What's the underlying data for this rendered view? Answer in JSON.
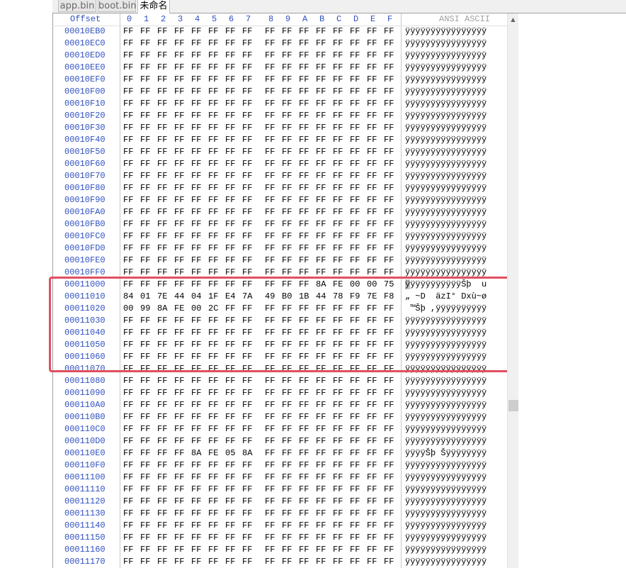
{
  "tabs": [
    {
      "label": "app.bin",
      "active": false
    },
    {
      "label": "boot.bin",
      "active": false
    },
    {
      "label": "未命名",
      "active": true
    }
  ],
  "header": {
    "offset_label": "Offset",
    "columns": [
      "0",
      "1",
      "2",
      "3",
      "4",
      "5",
      "6",
      "7",
      "8",
      "9",
      "A",
      "B",
      "C",
      "D",
      "E",
      "F"
    ],
    "ascii_label": "ANSI ASCII"
  },
  "rows": [
    {
      "offset": "00010EB0",
      "bytes": [
        "FF",
        "FF",
        "FF",
        "FF",
        "FF",
        "FF",
        "FF",
        "FF",
        "FF",
        "FF",
        "FF",
        "FF",
        "FF",
        "FF",
        "FF",
        "FF"
      ],
      "ascii": "ÿÿÿÿÿÿÿÿÿÿÿÿÿÿÿÿ"
    },
    {
      "offset": "00010EC0",
      "bytes": [
        "FF",
        "FF",
        "FF",
        "FF",
        "FF",
        "FF",
        "FF",
        "FF",
        "FF",
        "FF",
        "FF",
        "FF",
        "FF",
        "FF",
        "FF",
        "FF"
      ],
      "ascii": "ÿÿÿÿÿÿÿÿÿÿÿÿÿÿÿÿ"
    },
    {
      "offset": "00010ED0",
      "bytes": [
        "FF",
        "FF",
        "FF",
        "FF",
        "FF",
        "FF",
        "FF",
        "FF",
        "FF",
        "FF",
        "FF",
        "FF",
        "FF",
        "FF",
        "FF",
        "FF"
      ],
      "ascii": "ÿÿÿÿÿÿÿÿÿÿÿÿÿÿÿÿ"
    },
    {
      "offset": "00010EE0",
      "bytes": [
        "FF",
        "FF",
        "FF",
        "FF",
        "FF",
        "FF",
        "FF",
        "FF",
        "FF",
        "FF",
        "FF",
        "FF",
        "FF",
        "FF",
        "FF",
        "FF"
      ],
      "ascii": "ÿÿÿÿÿÿÿÿÿÿÿÿÿÿÿÿ"
    },
    {
      "offset": "00010EF0",
      "bytes": [
        "FF",
        "FF",
        "FF",
        "FF",
        "FF",
        "FF",
        "FF",
        "FF",
        "FF",
        "FF",
        "FF",
        "FF",
        "FF",
        "FF",
        "FF",
        "FF"
      ],
      "ascii": "ÿÿÿÿÿÿÿÿÿÿÿÿÿÿÿÿ"
    },
    {
      "offset": "00010F00",
      "bytes": [
        "FF",
        "FF",
        "FF",
        "FF",
        "FF",
        "FF",
        "FF",
        "FF",
        "FF",
        "FF",
        "FF",
        "FF",
        "FF",
        "FF",
        "FF",
        "FF"
      ],
      "ascii": "ÿÿÿÿÿÿÿÿÿÿÿÿÿÿÿÿ"
    },
    {
      "offset": "00010F10",
      "bytes": [
        "FF",
        "FF",
        "FF",
        "FF",
        "FF",
        "FF",
        "FF",
        "FF",
        "FF",
        "FF",
        "FF",
        "FF",
        "FF",
        "FF",
        "FF",
        "FF"
      ],
      "ascii": "ÿÿÿÿÿÿÿÿÿÿÿÿÿÿÿÿ"
    },
    {
      "offset": "00010F20",
      "bytes": [
        "FF",
        "FF",
        "FF",
        "FF",
        "FF",
        "FF",
        "FF",
        "FF",
        "FF",
        "FF",
        "FF",
        "FF",
        "FF",
        "FF",
        "FF",
        "FF"
      ],
      "ascii": "ÿÿÿÿÿÿÿÿÿÿÿÿÿÿÿÿ"
    },
    {
      "offset": "00010F30",
      "bytes": [
        "FF",
        "FF",
        "FF",
        "FF",
        "FF",
        "FF",
        "FF",
        "FF",
        "FF",
        "FF",
        "FF",
        "FF",
        "FF",
        "FF",
        "FF",
        "FF"
      ],
      "ascii": "ÿÿÿÿÿÿÿÿÿÿÿÿÿÿÿÿ"
    },
    {
      "offset": "00010F40",
      "bytes": [
        "FF",
        "FF",
        "FF",
        "FF",
        "FF",
        "FF",
        "FF",
        "FF",
        "FF",
        "FF",
        "FF",
        "FF",
        "FF",
        "FF",
        "FF",
        "FF"
      ],
      "ascii": "ÿÿÿÿÿÿÿÿÿÿÿÿÿÿÿÿ"
    },
    {
      "offset": "00010F50",
      "bytes": [
        "FF",
        "FF",
        "FF",
        "FF",
        "FF",
        "FF",
        "FF",
        "FF",
        "FF",
        "FF",
        "FF",
        "FF",
        "FF",
        "FF",
        "FF",
        "FF"
      ],
      "ascii": "ÿÿÿÿÿÿÿÿÿÿÿÿÿÿÿÿ"
    },
    {
      "offset": "00010F60",
      "bytes": [
        "FF",
        "FF",
        "FF",
        "FF",
        "FF",
        "FF",
        "FF",
        "FF",
        "FF",
        "FF",
        "FF",
        "FF",
        "FF",
        "FF",
        "FF",
        "FF"
      ],
      "ascii": "ÿÿÿÿÿÿÿÿÿÿÿÿÿÿÿÿ"
    },
    {
      "offset": "00010F70",
      "bytes": [
        "FF",
        "FF",
        "FF",
        "FF",
        "FF",
        "FF",
        "FF",
        "FF",
        "FF",
        "FF",
        "FF",
        "FF",
        "FF",
        "FF",
        "FF",
        "FF"
      ],
      "ascii": "ÿÿÿÿÿÿÿÿÿÿÿÿÿÿÿÿ"
    },
    {
      "offset": "00010F80",
      "bytes": [
        "FF",
        "FF",
        "FF",
        "FF",
        "FF",
        "FF",
        "FF",
        "FF",
        "FF",
        "FF",
        "FF",
        "FF",
        "FF",
        "FF",
        "FF",
        "FF"
      ],
      "ascii": "ÿÿÿÿÿÿÿÿÿÿÿÿÿÿÿÿ"
    },
    {
      "offset": "00010F90",
      "bytes": [
        "FF",
        "FF",
        "FF",
        "FF",
        "FF",
        "FF",
        "FF",
        "FF",
        "FF",
        "FF",
        "FF",
        "FF",
        "FF",
        "FF",
        "FF",
        "FF"
      ],
      "ascii": "ÿÿÿÿÿÿÿÿÿÿÿÿÿÿÿÿ"
    },
    {
      "offset": "00010FA0",
      "bytes": [
        "FF",
        "FF",
        "FF",
        "FF",
        "FF",
        "FF",
        "FF",
        "FF",
        "FF",
        "FF",
        "FF",
        "FF",
        "FF",
        "FF",
        "FF",
        "FF"
      ],
      "ascii": "ÿÿÿÿÿÿÿÿÿÿÿÿÿÿÿÿ"
    },
    {
      "offset": "00010FB0",
      "bytes": [
        "FF",
        "FF",
        "FF",
        "FF",
        "FF",
        "FF",
        "FF",
        "FF",
        "FF",
        "FF",
        "FF",
        "FF",
        "FF",
        "FF",
        "FF",
        "FF"
      ],
      "ascii": "ÿÿÿÿÿÿÿÿÿÿÿÿÿÿÿÿ"
    },
    {
      "offset": "00010FC0",
      "bytes": [
        "FF",
        "FF",
        "FF",
        "FF",
        "FF",
        "FF",
        "FF",
        "FF",
        "FF",
        "FF",
        "FF",
        "FF",
        "FF",
        "FF",
        "FF",
        "FF"
      ],
      "ascii": "ÿÿÿÿÿÿÿÿÿÿÿÿÿÿÿÿ"
    },
    {
      "offset": "00010FD0",
      "bytes": [
        "FF",
        "FF",
        "FF",
        "FF",
        "FF",
        "FF",
        "FF",
        "FF",
        "FF",
        "FF",
        "FF",
        "FF",
        "FF",
        "FF",
        "FF",
        "FF"
      ],
      "ascii": "ÿÿÿÿÿÿÿÿÿÿÿÿÿÿÿÿ"
    },
    {
      "offset": "00010FE0",
      "bytes": [
        "FF",
        "FF",
        "FF",
        "FF",
        "FF",
        "FF",
        "FF",
        "FF",
        "FF",
        "FF",
        "FF",
        "FF",
        "FF",
        "FF",
        "FF",
        "FF"
      ],
      "ascii": "ÿÿÿÿÿÿÿÿÿÿÿÿÿÿÿÿ"
    },
    {
      "offset": "00010FF0",
      "bytes": [
        "FF",
        "FF",
        "FF",
        "FF",
        "FF",
        "FF",
        "FF",
        "FF",
        "FF",
        "FF",
        "FF",
        "FF",
        "FF",
        "FF",
        "FF",
        "FF"
      ],
      "ascii": "ÿÿÿÿÿÿÿÿÿÿÿÿÿÿÿÿ"
    },
    {
      "offset": "00011000",
      "bytes": [
        "FF",
        "FF",
        "FF",
        "FF",
        "FF",
        "FF",
        "FF",
        "FF",
        "FF",
        "FF",
        "FF",
        "8A",
        "FE",
        "00",
        "00",
        "75"
      ],
      "ascii": "ÿÿÿÿÿÿÿÿÿÿÿŠþ  u"
    },
    {
      "offset": "00011010",
      "bytes": [
        "84",
        "01",
        "7E",
        "44",
        "04",
        "1F",
        "E4",
        "7A",
        "49",
        "B0",
        "1B",
        "44",
        "78",
        "F9",
        "7E",
        "F8"
      ],
      "ascii": "„ ~D  äzI° Dxù~ø"
    },
    {
      "offset": "00011020",
      "bytes": [
        "00",
        "99",
        "8A",
        "FE",
        "00",
        "2C",
        "FF",
        "FF",
        "FF",
        "FF",
        "FF",
        "FF",
        "FF",
        "FF",
        "FF",
        "FF"
      ],
      "ascii": " ™Šþ ,ÿÿÿÿÿÿÿÿÿÿ"
    },
    {
      "offset": "00011030",
      "bytes": [
        "FF",
        "FF",
        "FF",
        "FF",
        "FF",
        "FF",
        "FF",
        "FF",
        "FF",
        "FF",
        "FF",
        "FF",
        "FF",
        "FF",
        "FF",
        "FF"
      ],
      "ascii": "ÿÿÿÿÿÿÿÿÿÿÿÿÿÿÿÿ"
    },
    {
      "offset": "00011040",
      "bytes": [
        "FF",
        "FF",
        "FF",
        "FF",
        "FF",
        "FF",
        "FF",
        "FF",
        "FF",
        "FF",
        "FF",
        "FF",
        "FF",
        "FF",
        "FF",
        "FF"
      ],
      "ascii": "ÿÿÿÿÿÿÿÿÿÿÿÿÿÿÿÿ"
    },
    {
      "offset": "00011050",
      "bytes": [
        "FF",
        "FF",
        "FF",
        "FF",
        "FF",
        "FF",
        "FF",
        "FF",
        "FF",
        "FF",
        "FF",
        "FF",
        "FF",
        "FF",
        "FF",
        "FF"
      ],
      "ascii": "ÿÿÿÿÿÿÿÿÿÿÿÿÿÿÿÿ"
    },
    {
      "offset": "00011060",
      "bytes": [
        "FF",
        "FF",
        "FF",
        "FF",
        "FF",
        "FF",
        "FF",
        "FF",
        "FF",
        "FF",
        "FF",
        "FF",
        "FF",
        "FF",
        "FF",
        "FF"
      ],
      "ascii": "ÿÿÿÿÿÿÿÿÿÿÿÿÿÿÿÿ"
    },
    {
      "offset": "00011070",
      "bytes": [
        "FF",
        "FF",
        "FF",
        "FF",
        "FF",
        "FF",
        "FF",
        "FF",
        "FF",
        "FF",
        "FF",
        "FF",
        "FF",
        "FF",
        "FF",
        "FF"
      ],
      "ascii": "ÿÿÿÿÿÿÿÿÿÿÿÿÿÿÿÿ"
    },
    {
      "offset": "00011080",
      "bytes": [
        "FF",
        "FF",
        "FF",
        "FF",
        "FF",
        "FF",
        "FF",
        "FF",
        "FF",
        "FF",
        "FF",
        "FF",
        "FF",
        "FF",
        "FF",
        "FF"
      ],
      "ascii": "ÿÿÿÿÿÿÿÿÿÿÿÿÿÿÿÿ"
    },
    {
      "offset": "00011090",
      "bytes": [
        "FF",
        "FF",
        "FF",
        "FF",
        "FF",
        "FF",
        "FF",
        "FF",
        "FF",
        "FF",
        "FF",
        "FF",
        "FF",
        "FF",
        "FF",
        "FF"
      ],
      "ascii": "ÿÿÿÿÿÿÿÿÿÿÿÿÿÿÿÿ"
    },
    {
      "offset": "000110A0",
      "bytes": [
        "FF",
        "FF",
        "FF",
        "FF",
        "FF",
        "FF",
        "FF",
        "FF",
        "FF",
        "FF",
        "FF",
        "FF",
        "FF",
        "FF",
        "FF",
        "FF"
      ],
      "ascii": "ÿÿÿÿÿÿÿÿÿÿÿÿÿÿÿÿ"
    },
    {
      "offset": "000110B0",
      "bytes": [
        "FF",
        "FF",
        "FF",
        "FF",
        "FF",
        "FF",
        "FF",
        "FF",
        "FF",
        "FF",
        "FF",
        "FF",
        "FF",
        "FF",
        "FF",
        "FF"
      ],
      "ascii": "ÿÿÿÿÿÿÿÿÿÿÿÿÿÿÿÿ"
    },
    {
      "offset": "000110C0",
      "bytes": [
        "FF",
        "FF",
        "FF",
        "FF",
        "FF",
        "FF",
        "FF",
        "FF",
        "FF",
        "FF",
        "FF",
        "FF",
        "FF",
        "FF",
        "FF",
        "FF"
      ],
      "ascii": "ÿÿÿÿÿÿÿÿÿÿÿÿÿÿÿÿ"
    },
    {
      "offset": "000110D0",
      "bytes": [
        "FF",
        "FF",
        "FF",
        "FF",
        "FF",
        "FF",
        "FF",
        "FF",
        "FF",
        "FF",
        "FF",
        "FF",
        "FF",
        "FF",
        "FF",
        "FF"
      ],
      "ascii": "ÿÿÿÿÿÿÿÿÿÿÿÿÿÿÿÿ"
    },
    {
      "offset": "000110E0",
      "bytes": [
        "FF",
        "FF",
        "FF",
        "FF",
        "8A",
        "FE",
        "05",
        "8A",
        "FF",
        "FF",
        "FF",
        "FF",
        "FF",
        "FF",
        "FF",
        "FF"
      ],
      "ascii": "ÿÿÿÿŠþ Šÿÿÿÿÿÿÿÿ"
    },
    {
      "offset": "000110F0",
      "bytes": [
        "FF",
        "FF",
        "FF",
        "FF",
        "FF",
        "FF",
        "FF",
        "FF",
        "FF",
        "FF",
        "FF",
        "FF",
        "FF",
        "FF",
        "FF",
        "FF"
      ],
      "ascii": "ÿÿÿÿÿÿÿÿÿÿÿÿÿÿÿÿ"
    },
    {
      "offset": "00011100",
      "bytes": [
        "FF",
        "FF",
        "FF",
        "FF",
        "FF",
        "FF",
        "FF",
        "FF",
        "FF",
        "FF",
        "FF",
        "FF",
        "FF",
        "FF",
        "FF",
        "FF"
      ],
      "ascii": "ÿÿÿÿÿÿÿÿÿÿÿÿÿÿÿÿ"
    },
    {
      "offset": "00011110",
      "bytes": [
        "FF",
        "FF",
        "FF",
        "FF",
        "FF",
        "FF",
        "FF",
        "FF",
        "FF",
        "FF",
        "FF",
        "FF",
        "FF",
        "FF",
        "FF",
        "FF"
      ],
      "ascii": "ÿÿÿÿÿÿÿÿÿÿÿÿÿÿÿÿ"
    },
    {
      "offset": "00011120",
      "bytes": [
        "FF",
        "FF",
        "FF",
        "FF",
        "FF",
        "FF",
        "FF",
        "FF",
        "FF",
        "FF",
        "FF",
        "FF",
        "FF",
        "FF",
        "FF",
        "FF"
      ],
      "ascii": "ÿÿÿÿÿÿÿÿÿÿÿÿÿÿÿÿ"
    },
    {
      "offset": "00011130",
      "bytes": [
        "FF",
        "FF",
        "FF",
        "FF",
        "FF",
        "FF",
        "FF",
        "FF",
        "FF",
        "FF",
        "FF",
        "FF",
        "FF",
        "FF",
        "FF",
        "FF"
      ],
      "ascii": "ÿÿÿÿÿÿÿÿÿÿÿÿÿÿÿÿ"
    },
    {
      "offset": "00011140",
      "bytes": [
        "FF",
        "FF",
        "FF",
        "FF",
        "FF",
        "FF",
        "FF",
        "FF",
        "FF",
        "FF",
        "FF",
        "FF",
        "FF",
        "FF",
        "FF",
        "FF"
      ],
      "ascii": "ÿÿÿÿÿÿÿÿÿÿÿÿÿÿÿÿ"
    },
    {
      "offset": "00011150",
      "bytes": [
        "FF",
        "FF",
        "FF",
        "FF",
        "FF",
        "FF",
        "FF",
        "FF",
        "FF",
        "FF",
        "FF",
        "FF",
        "FF",
        "FF",
        "FF",
        "FF"
      ],
      "ascii": "ÿÿÿÿÿÿÿÿÿÿÿÿÿÿÿÿ"
    },
    {
      "offset": "00011160",
      "bytes": [
        "FF",
        "FF",
        "FF",
        "FF",
        "FF",
        "FF",
        "FF",
        "FF",
        "FF",
        "FF",
        "FF",
        "FF",
        "FF",
        "FF",
        "FF",
        "FF"
      ],
      "ascii": "ÿÿÿÿÿÿÿÿÿÿÿÿÿÿÿÿ"
    },
    {
      "offset": "00011170",
      "bytes": [
        "FF",
        "FF",
        "FF",
        "FF",
        "FF",
        "FF",
        "FF",
        "FF",
        "FF",
        "FF",
        "FF",
        "FF",
        "FF",
        "FF",
        "FF",
        "FF"
      ],
      "ascii": "ÿÿÿÿÿÿÿÿÿÿÿÿÿÿÿÿ"
    }
  ],
  "colors": {
    "offset_text": "#3050c0",
    "highlight_border": "#e0505f",
    "cursor_bg": "#c6c6c6"
  },
  "cursor": {
    "row_offset": "00011000",
    "ascii_index": 0
  },
  "highlight": {
    "from_offset": "00011000",
    "to_offset": "00011060"
  }
}
